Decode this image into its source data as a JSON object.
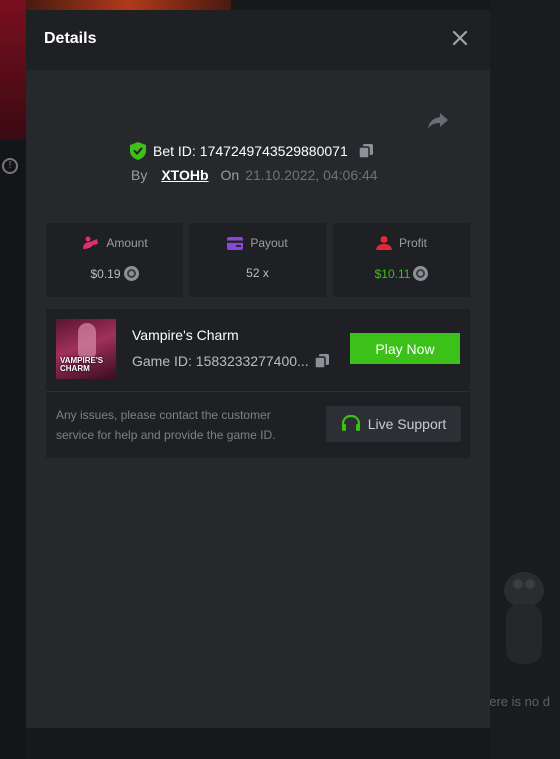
{
  "modal": {
    "title": "Details"
  },
  "bet": {
    "label": "Bet ID:",
    "id": "1747249743529880071",
    "by_label": "By",
    "user": "XTOHb",
    "on_label": "On",
    "datetime": "21.10.2022, 04:06:44"
  },
  "stats": [
    {
      "label": "Amount",
      "value": "$0.19",
      "icon": "amount-icon",
      "value_color": "#b9bcc2"
    },
    {
      "label": "Payout",
      "value": "52 x",
      "icon": "payout-card-icon",
      "value_color": "#b9bcc2"
    },
    {
      "label": "Profit",
      "value": "$10.11",
      "icon": "profit-icon",
      "value_color": "#3bc117"
    }
  ],
  "game": {
    "thumb_title": "VAMPIRE'S CHARM",
    "name": "Vampire's Charm",
    "id_label": "Game ID: 1583233277400...",
    "play_label": "Play Now",
    "issue_text": "Any issues, please contact the customer service for help and provide the game ID.",
    "support_label": "Live Support"
  },
  "background": {
    "bottom_text": "here is no d"
  },
  "colors": {
    "accent_green": "#3bc117",
    "amount_pink": "#e0306a",
    "payout_purple": "#8b45e0",
    "profit_red": "#e02a3a"
  }
}
